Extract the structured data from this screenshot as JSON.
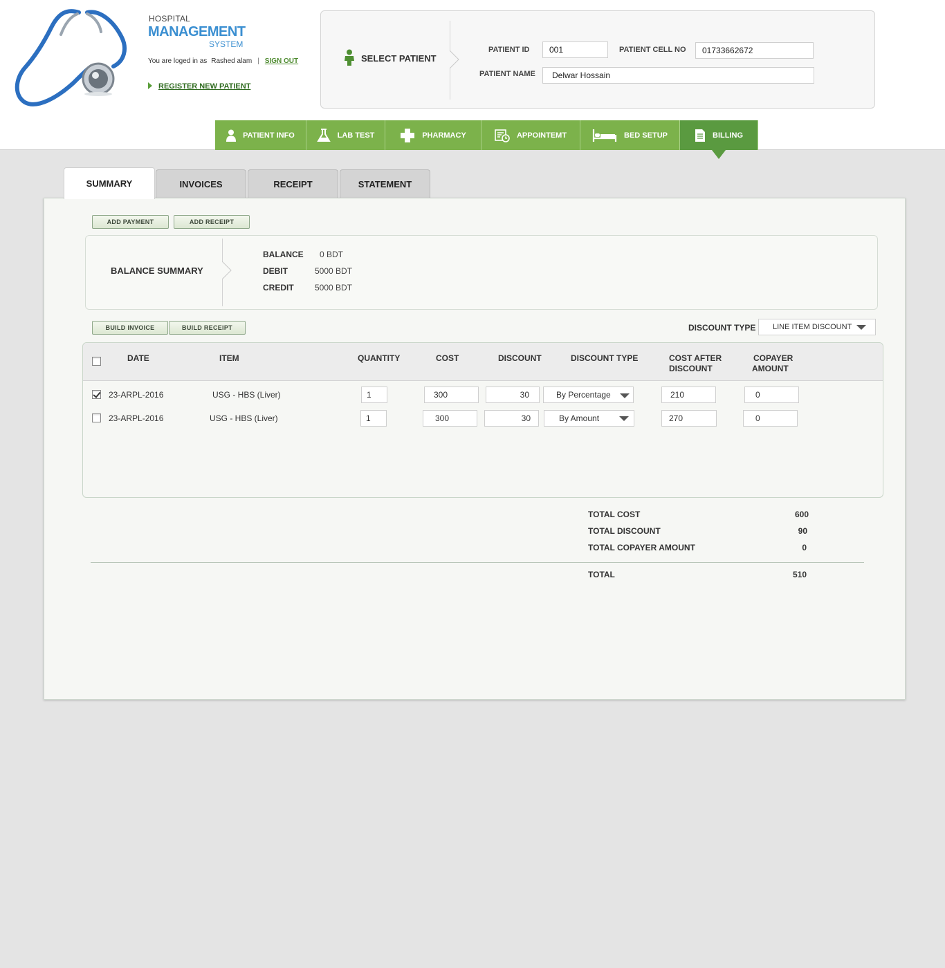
{
  "brand": {
    "line1": "HOSPITAL",
    "line2": "MANAGEMENT",
    "line3": "SYSTEM"
  },
  "session": {
    "logged_prefix": "You are loged in as",
    "user": "Rashed alam",
    "separator": "|",
    "sign_out": "SIGN OUT"
  },
  "register_label": "REGISTER NEW PATIENT",
  "patient": {
    "select_label": "SELECT PATIENT",
    "id_label": "PATIENT ID",
    "id_value": "001",
    "cell_label": "PATIENT CELL NO",
    "cell_value": "01733662672",
    "name_label": "PATIENT NAME",
    "name_value": "Delwar Hossain"
  },
  "nav": [
    {
      "label": "PATIENT INFO",
      "icon": "person-icon"
    },
    {
      "label": "LAB TEST",
      "icon": "flask-icon"
    },
    {
      "label": "PHARMACY",
      "icon": "medical-cross-icon"
    },
    {
      "label": "APPOINTEMT",
      "icon": "calendar-clock-icon"
    },
    {
      "label": "BED SETUP",
      "icon": "bed-icon"
    },
    {
      "label": "BILLING",
      "icon": "document-icon",
      "active": true
    }
  ],
  "tabs": [
    {
      "label": "SUMMARY",
      "active": true
    },
    {
      "label": "INVOICES"
    },
    {
      "label": "RECEIPT"
    },
    {
      "label": "STATEMENT"
    }
  ],
  "actions": {
    "add_payment": "ADD  PAYMENT",
    "add_receipt": "ADD RECEIPT",
    "build_invoice": "BUILD INVOICE",
    "build_receipt": "BUILD RECEIPT"
  },
  "balance": {
    "title": "BALANCE SUMMARY",
    "balance_label": "BALANCE",
    "balance_value": "0 BDT",
    "debit_label": "DEBIT",
    "debit_value": "5000 BDT",
    "credit_label": "CREDIT",
    "credit_value": "5000 BDT"
  },
  "discount_type": {
    "label": "DISCOUNT TYPE",
    "value": "LINE ITEM DISCOUNT"
  },
  "table": {
    "headers": {
      "date": "DATE",
      "item": "ITEM",
      "quantity": "QUANTITY",
      "cost": "COST",
      "discount": "DISCOUNT",
      "discount_type": "DISCOUNT TYPE",
      "cost_after_1": "COST AFTER",
      "cost_after_2": "DISCOUNT",
      "copayer_1": "COPAYER",
      "copayer_2": "AMOUNT"
    },
    "rows": [
      {
        "checked": true,
        "date": "23-ARPL-2016",
        "item": "USG - HBS (Liver)",
        "quantity": "1",
        "cost": "300",
        "discount": "30",
        "discount_type": "By Percentage",
        "cost_after": "210",
        "copayer": "0"
      },
      {
        "checked": false,
        "date": "23-ARPL-2016",
        "item": "USG - HBS (Liver)",
        "quantity": "1",
        "cost": "300",
        "discount": "30",
        "discount_type": "By Amount",
        "cost_after": "270",
        "copayer": "0"
      }
    ]
  },
  "totals": {
    "total_cost_label": "TOTAL COST",
    "total_cost": "600",
    "total_discount_label": "TOTAL DISCOUNT",
    "total_discount": "90",
    "total_copayer_label": "TOTAL COPAYER AMOUNT",
    "total_copayer": "0",
    "total_label": "TOTAL",
    "total": "510"
  },
  "colors": {
    "nav_green": "#7cb24b",
    "nav_active": "#5a9a40",
    "brand_blue": "#3b8fd1",
    "link_green": "#4d8a2e"
  }
}
